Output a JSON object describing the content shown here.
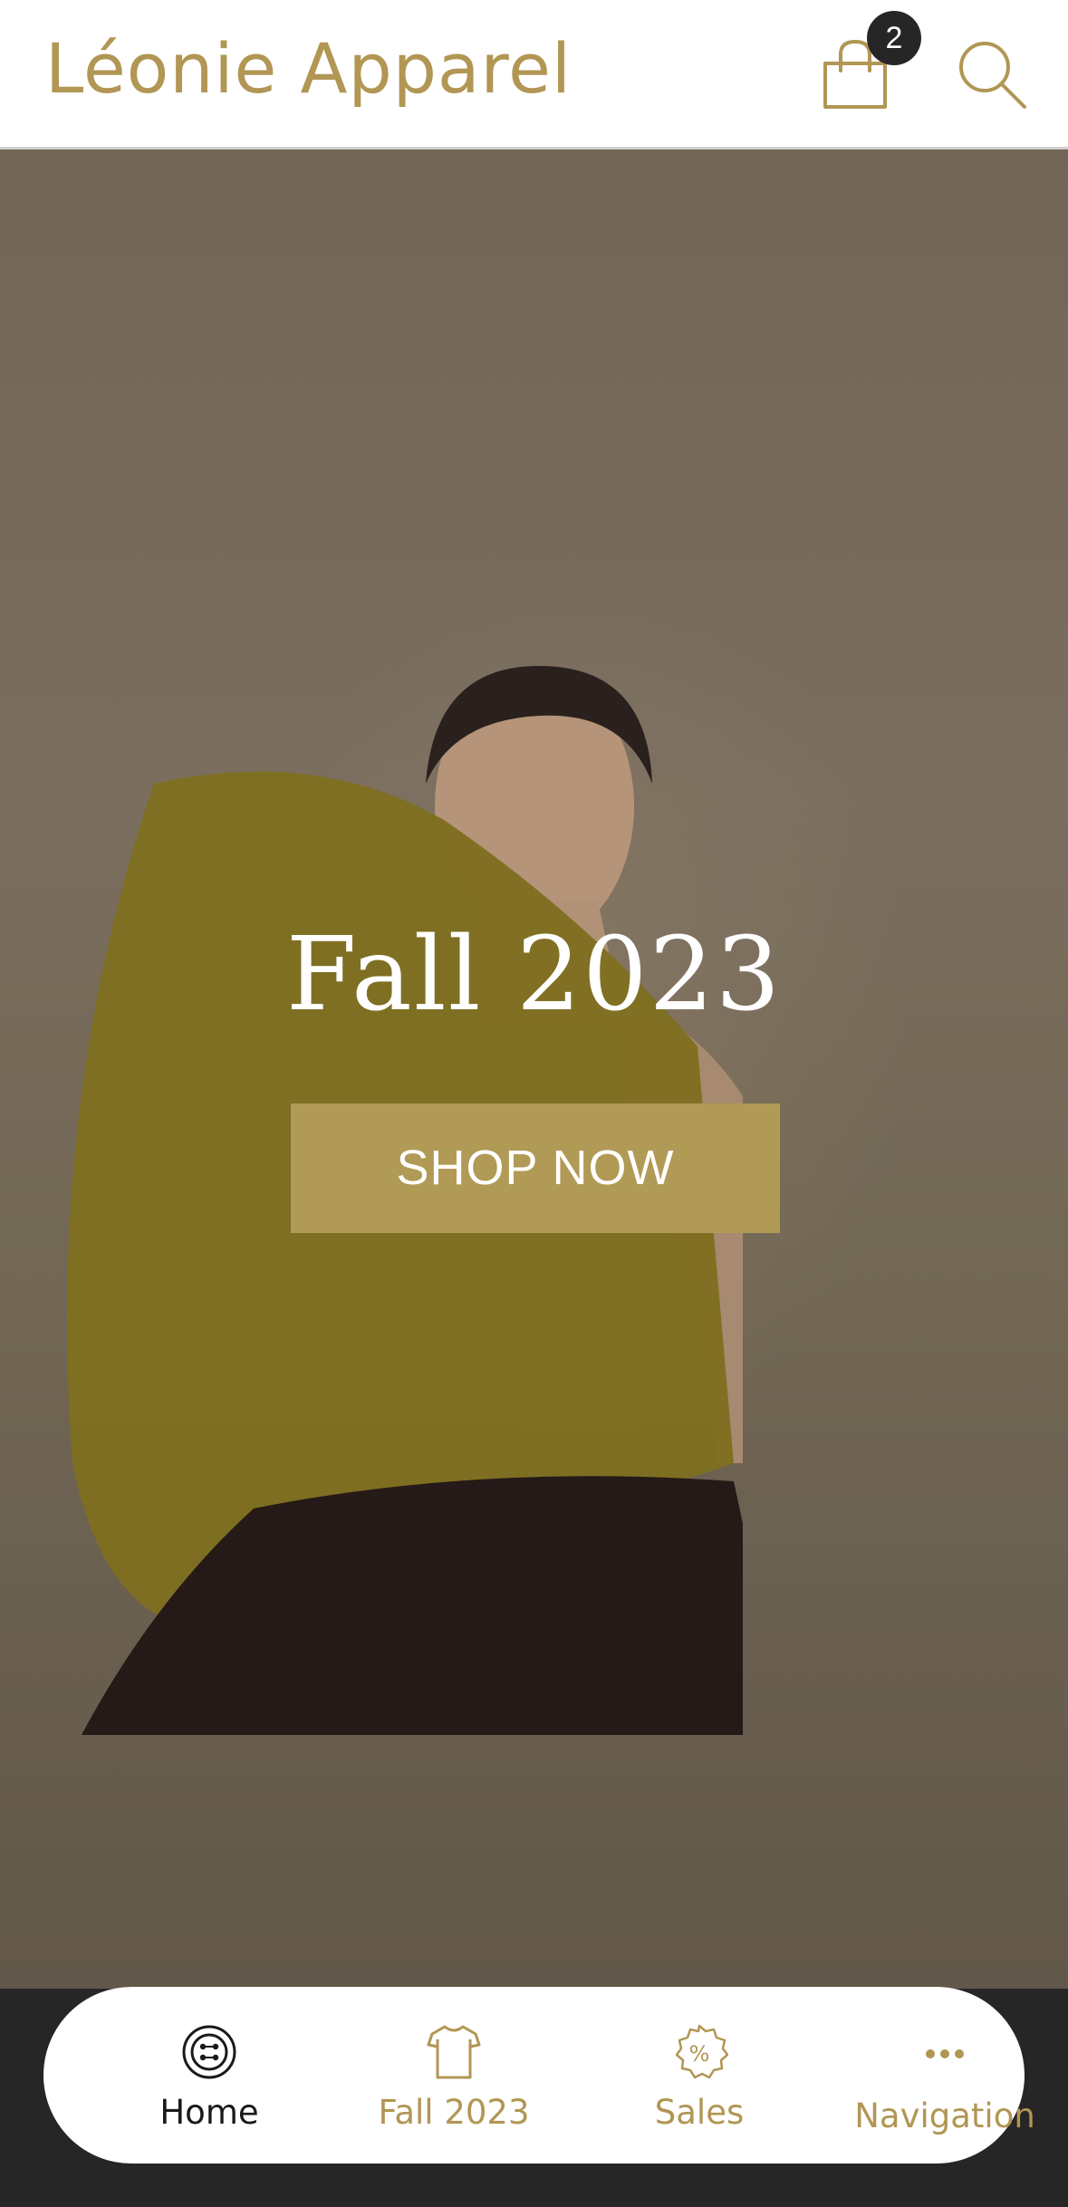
{
  "header": {
    "brand": "Léonie Apparel",
    "cart_count": "2",
    "cart_icon": "shopping-bag-icon",
    "search_icon": "search-icon"
  },
  "hero": {
    "title": "Fall 2023",
    "cta_label": "SHOP NOW"
  },
  "bottom_nav": {
    "items": [
      {
        "label": "Home",
        "icon": "button-icon",
        "active": true
      },
      {
        "label": "Fall 2023",
        "icon": "tshirt-icon",
        "active": false
      },
      {
        "label": "Sales",
        "icon": "discount-badge-icon",
        "active": false
      },
      {
        "label": "Navigation",
        "icon": "more-dots-icon",
        "active": false
      }
    ]
  },
  "colors": {
    "brand": "#b19654",
    "cta_background": "#b19a56",
    "badge": "#262626",
    "nav_bar_background": "#262626"
  }
}
